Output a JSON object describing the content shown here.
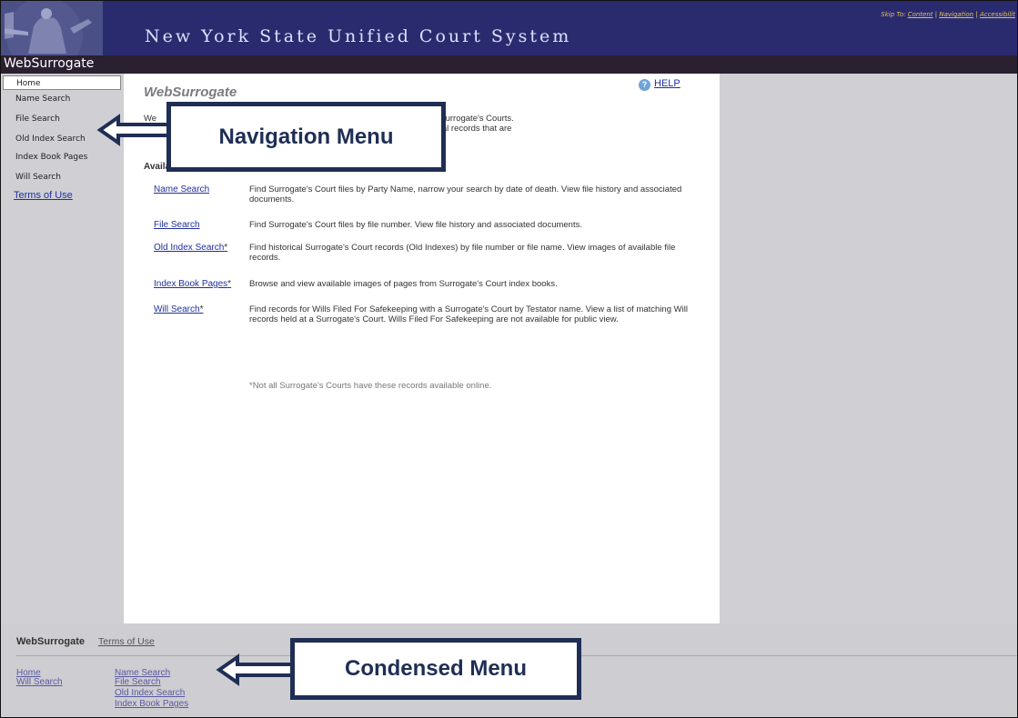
{
  "header": {
    "site_title": "New York State Unified Court System",
    "skip_label": "Skip To:",
    "skip_links": [
      "Content",
      "Navigation",
      "Accessibilit"
    ],
    "app_name": "WebSurrogate"
  },
  "sidebar": {
    "items": [
      {
        "label": "Home"
      },
      {
        "label": "Name Search"
      },
      {
        "label": "File Search"
      },
      {
        "label": "Old Index Search"
      },
      {
        "label": "Index Book Pages"
      },
      {
        "label": "Will Search"
      }
    ],
    "terms_label": "Terms of Use"
  },
  "main": {
    "title": "WebSurrogate",
    "help_label": "HELP",
    "intro_start": "We",
    "intro_frag1": "r filings within New York State Surrogate's Courts.",
    "intro_frag2": "e documents, and view historical records that are",
    "options_heading": "Available Search Options",
    "options": [
      {
        "link": "Name Search",
        "star": "",
        "desc": "Find Surrogate's Court files by Party Name, narrow your search by date of death. View file history and associated documents."
      },
      {
        "link": "File Search",
        "star": "",
        "desc": "Find Surrogate's Court files by file number. View file history and associated documents."
      },
      {
        "link": "Old Index Search",
        "star": "*",
        "desc": "Find historical Surrogate's Court records (Old Indexes) by file number or file name. View images of available file records."
      },
      {
        "link": "Index Book Pages",
        "star": "*",
        "desc": "Browse and view available images of pages from Surrogate's Court index books."
      },
      {
        "link": "Will Search",
        "star": "*",
        "desc": "Find records for Wills Filed For Safekeeping with a Surrogate's Court by Testator name. View a list of matching Will records held at a Surrogate's Court. Wills Filed For Safekeeping are not available for public view."
      }
    ],
    "footnote": "*Not all Surrogate's Courts have these records available online."
  },
  "footer": {
    "brand": "WebSurrogate",
    "terms_label": "Terms of Use",
    "col1": [
      "Home",
      "Will Search"
    ],
    "col2": [
      "Name Search",
      "File Search",
      "Old Index Search",
      "Index Book Pages"
    ]
  },
  "callouts": {
    "nav": "Navigation Menu",
    "condensed": "Condensed Menu"
  },
  "colors": {
    "header_bg": "#2a2b6e",
    "appbar_bg": "#2b2030",
    "sidebar_bg": "#cfcfd4",
    "link": "#2030a0",
    "callout": "#1f2e54"
  }
}
